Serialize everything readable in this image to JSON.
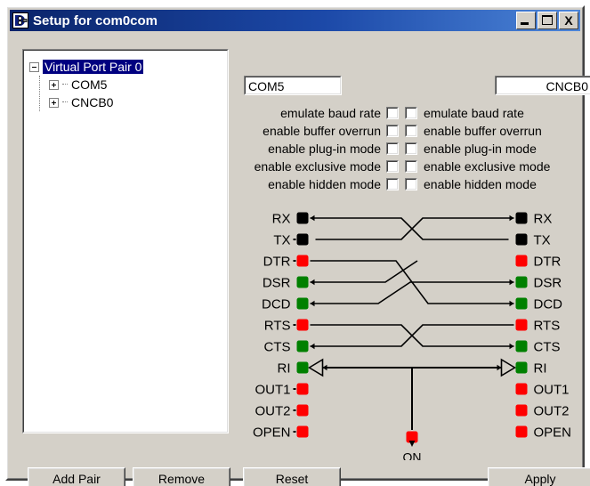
{
  "window": {
    "title": "Setup for com0com",
    "icon": "app-icon",
    "buttons": {
      "minimize": "minimize-icon",
      "maximize": "maximize-icon",
      "close": "X"
    }
  },
  "tree": {
    "root": {
      "label": "Virtual Port Pair 0",
      "expander": "minus",
      "selected": true
    },
    "children": [
      {
        "label": "COM5",
        "expander": "plus"
      },
      {
        "label": "CNCB0",
        "expander": "plus"
      }
    ]
  },
  "ports": {
    "left": {
      "name": "COM5"
    },
    "right": {
      "name": "CNCB0"
    }
  },
  "options": [
    {
      "label": "emulate baud rate",
      "left_checked": false,
      "right_checked": false
    },
    {
      "label": "enable buffer overrun",
      "left_checked": false,
      "right_checked": false
    },
    {
      "label": "enable plug-in mode",
      "left_checked": false,
      "right_checked": false
    },
    {
      "label": "enable exclusive mode",
      "left_checked": false,
      "right_checked": false
    },
    {
      "label": "enable hidden mode",
      "left_checked": false,
      "right_checked": false
    }
  ],
  "diagram": {
    "on_label": "ON",
    "colors": {
      "black": "#000000",
      "red": "#ff0000",
      "green": "#008000",
      "wire": "#000000",
      "background": "#d4d0c8"
    },
    "signals": [
      {
        "name": "RX",
        "left_label": "RX",
        "right_label": "RX",
        "color": "black"
      },
      {
        "name": "TX",
        "left_label": "TX",
        "right_label": "TX",
        "color": "black"
      },
      {
        "name": "DTR",
        "left_label": "DTR",
        "right_label": "DTR",
        "color": "red"
      },
      {
        "name": "DSR",
        "left_label": "DSR",
        "right_label": "DSR",
        "color": "green"
      },
      {
        "name": "DCD",
        "left_label": "DCD",
        "right_label": "DCD",
        "color": "green"
      },
      {
        "name": "RTS",
        "left_label": "RTS",
        "right_label": "RTS",
        "color": "red"
      },
      {
        "name": "CTS",
        "left_label": "CTS",
        "right_label": "CTS",
        "color": "green"
      },
      {
        "name": "RI",
        "left_label": "RI",
        "right_label": "RI",
        "color": "green"
      },
      {
        "name": "OUT1",
        "left_label": "OUT1",
        "right_label": "OUT1",
        "color": "red"
      },
      {
        "name": "OUT2",
        "left_label": "OUT2",
        "right_label": "OUT2",
        "color": "red"
      },
      {
        "name": "OPEN",
        "left_label": "OPEN",
        "right_label": "OPEN",
        "color": "red"
      }
    ],
    "connections": [
      {
        "from": "TX-left",
        "to": "RX-right"
      },
      {
        "from": "TX-right",
        "to": "RX-left"
      },
      {
        "from": "DTR-left",
        "to": "DSR-right"
      },
      {
        "from": "DTR-left",
        "to": "DCD-right"
      },
      {
        "from": "DTR-right",
        "to": "DSR-left"
      },
      {
        "from": "DTR-right",
        "to": "DCD-left"
      },
      {
        "from": "RTS-left",
        "to": "CTS-right"
      },
      {
        "from": "RTS-right",
        "to": "CTS-left"
      },
      {
        "from": "ON",
        "to": "RI-left"
      },
      {
        "from": "ON",
        "to": "RI-right"
      }
    ]
  },
  "buttons": {
    "add_pair": "Add Pair",
    "remove": "Remove",
    "reset": "Reset",
    "apply": "Apply"
  }
}
